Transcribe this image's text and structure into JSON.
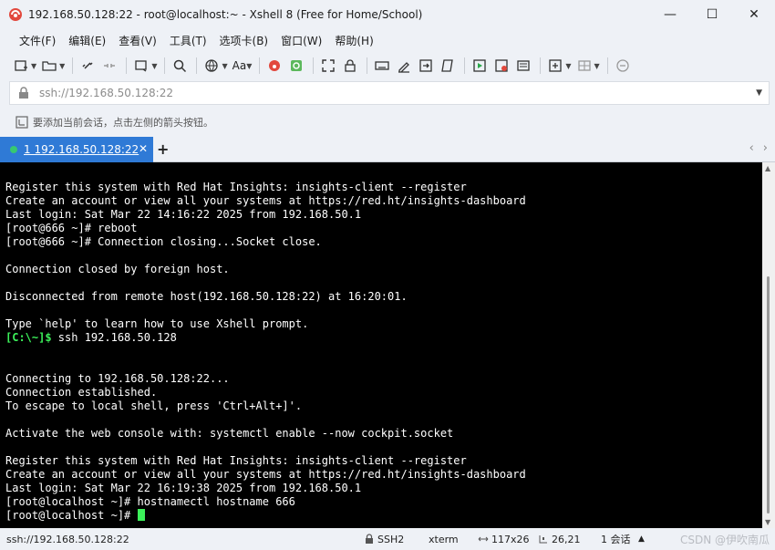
{
  "window": {
    "title": "192.168.50.128:22 - root@localhost:~ - Xshell 8 (Free for Home/School)",
    "controls": {
      "minimize": "—",
      "maximize": "☐",
      "close": "✕"
    }
  },
  "menu": [
    "文件(F)",
    "编辑(E)",
    "查看(V)",
    "工具(T)",
    "选项卡(B)",
    "窗口(W)",
    "帮助(H)"
  ],
  "toolbar": {
    "font_label": "Aa"
  },
  "address": {
    "value": "ssh://192.168.50.128:22"
  },
  "hint": {
    "text": "要添加当前会话，点击左侧的箭头按钮。"
  },
  "tab": {
    "label": "1 192.168.50.128:22",
    "close": "✕",
    "add": "+",
    "prev": "‹",
    "next": "›"
  },
  "terminal": {
    "lines": [
      "Register this system with Red Hat Insights: insights-client --register",
      "Create an account or view all your systems at https://red.ht/insights-dashboard",
      "Last login: Sat Mar 22 14:16:22 2025 from 192.168.50.1",
      "[root@666 ~]# reboot",
      "[root@666 ~]# Connection closing...Socket close.",
      "",
      "Connection closed by foreign host.",
      "",
      "Disconnected from remote host(192.168.50.128:22) at 16:20:01.",
      "",
      "Type `help' to learn how to use Xshell prompt."
    ],
    "local_prompt": "[C:\\~]$",
    "local_command": " ssh 192.168.50.128",
    "lines_after": [
      "",
      "",
      "Connecting to 192.168.50.128:22...",
      "Connection established.",
      "To escape to local shell, press 'Ctrl+Alt+]'.",
      "",
      "Activate the web console with: systemctl enable --now cockpit.socket",
      "",
      "Register this system with Red Hat Insights: insights-client --register",
      "Create an account or view all your systems at https://red.ht/insights-dashboard",
      "Last login: Sat Mar 22 16:19:38 2025 from 192.168.50.1",
      "[root@localhost ~]# hostnamectl hostname 666"
    ],
    "final_prompt": "[root@localhost ~]# "
  },
  "status": {
    "host": "ssh://192.168.50.128:22",
    "protocol": "SSH2",
    "term": "xterm",
    "size": "117x26",
    "cursor": "26,21",
    "sessions": "1 会话",
    "watermark": "CSDN @伊吹南瓜"
  },
  "colors": {
    "tab_active": "#2f7ad6",
    "terminal_bg": "#000000",
    "prompt_green": "#3cf05a"
  }
}
